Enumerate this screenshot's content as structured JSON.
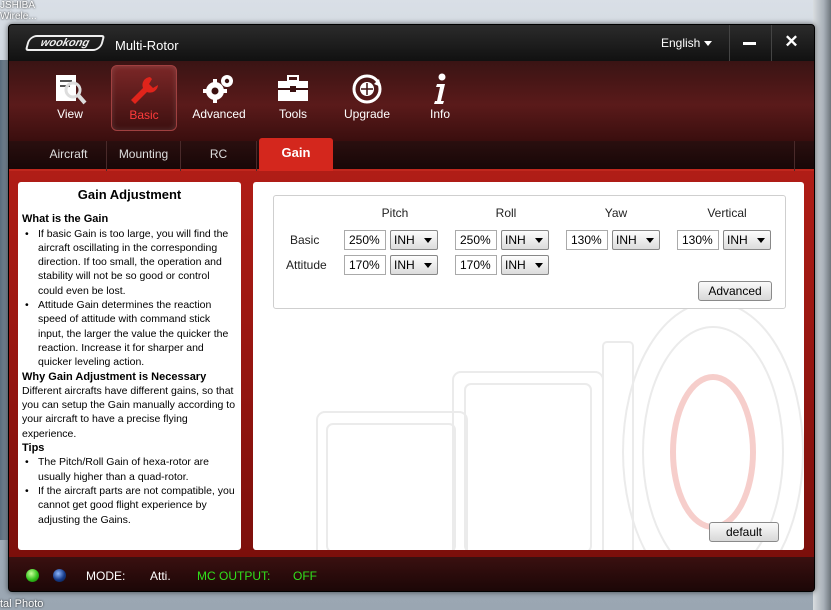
{
  "desktop": {
    "top_text_1": "JSHIBA",
    "top_text_2": "Wirele...",
    "bottom_text": "tal Photo"
  },
  "window": {
    "logo_text": "wookong",
    "title": "Multi-Rotor",
    "language": "English",
    "close_glyph": "✕"
  },
  "toolbar": [
    {
      "label": "View",
      "icon": "view-magnifier-icon"
    },
    {
      "label": "Basic",
      "icon": "wrench-icon",
      "active": true
    },
    {
      "label": "Advanced",
      "icon": "gears-icon"
    },
    {
      "label": "Tools",
      "icon": "toolbox-icon"
    },
    {
      "label": "Upgrade",
      "icon": "upgrade-globe-icon"
    },
    {
      "label": "Info",
      "icon": "info-icon"
    }
  ],
  "subtabs": [
    {
      "label": "Aircraft"
    },
    {
      "label": "Mounting"
    },
    {
      "label": "RC"
    },
    {
      "label": "Gain",
      "active": true
    }
  ],
  "help": {
    "title": "Gain Adjustment",
    "sec1": "What is the Gain",
    "sec1_items": [
      "If basic Gain is too large, you will find the aircraft oscillating in the corresponding direction. If too small, the operation and stability will not be so good or control could even be lost.",
      "Attitude Gain determines the reaction speed of attitude with command stick input, the larger the value the quicker the reaction. Increase it for sharper and quicker leveling action."
    ],
    "sec2": "Why Gain Adjustment is Necessary",
    "sec2_text": "Different aircrafts have different gains, so that you can setup the Gain manually according to your aircraft to have a precise flying experience.",
    "sec3": "Tips",
    "sec3_items": [
      "The Pitch/Roll Gain of hexa-rotor are usually higher than a quad-rotor.",
      "If the aircraft parts are not compatible, you cannot get good flight experience by adjusting the Gains."
    ]
  },
  "gain": {
    "columns": {
      "pitch": "Pitch",
      "roll": "Roll",
      "yaw": "Yaw",
      "vertical": "Vertical"
    },
    "rows": {
      "basic": "Basic",
      "attitude": "Attitude"
    },
    "basic": {
      "pitch": {
        "value": "250%",
        "mode": "INH"
      },
      "roll": {
        "value": "250%",
        "mode": "INH"
      },
      "yaw": {
        "value": "130%",
        "mode": "INH"
      },
      "vertical": {
        "value": "130%",
        "mode": "INH"
      }
    },
    "attitude": {
      "pitch": {
        "value": "170%",
        "mode": "INH"
      },
      "roll": {
        "value": "170%",
        "mode": "INH"
      }
    },
    "advanced_label": "Advanced",
    "default_label": "default"
  },
  "status": {
    "mode_label": "MODE:",
    "mode_value": "Atti.",
    "mc_output_label": "MC OUTPUT:",
    "mc_output_value": "OFF",
    "colors": {
      "mode": "#ffffff",
      "output": "#31e01c"
    }
  }
}
